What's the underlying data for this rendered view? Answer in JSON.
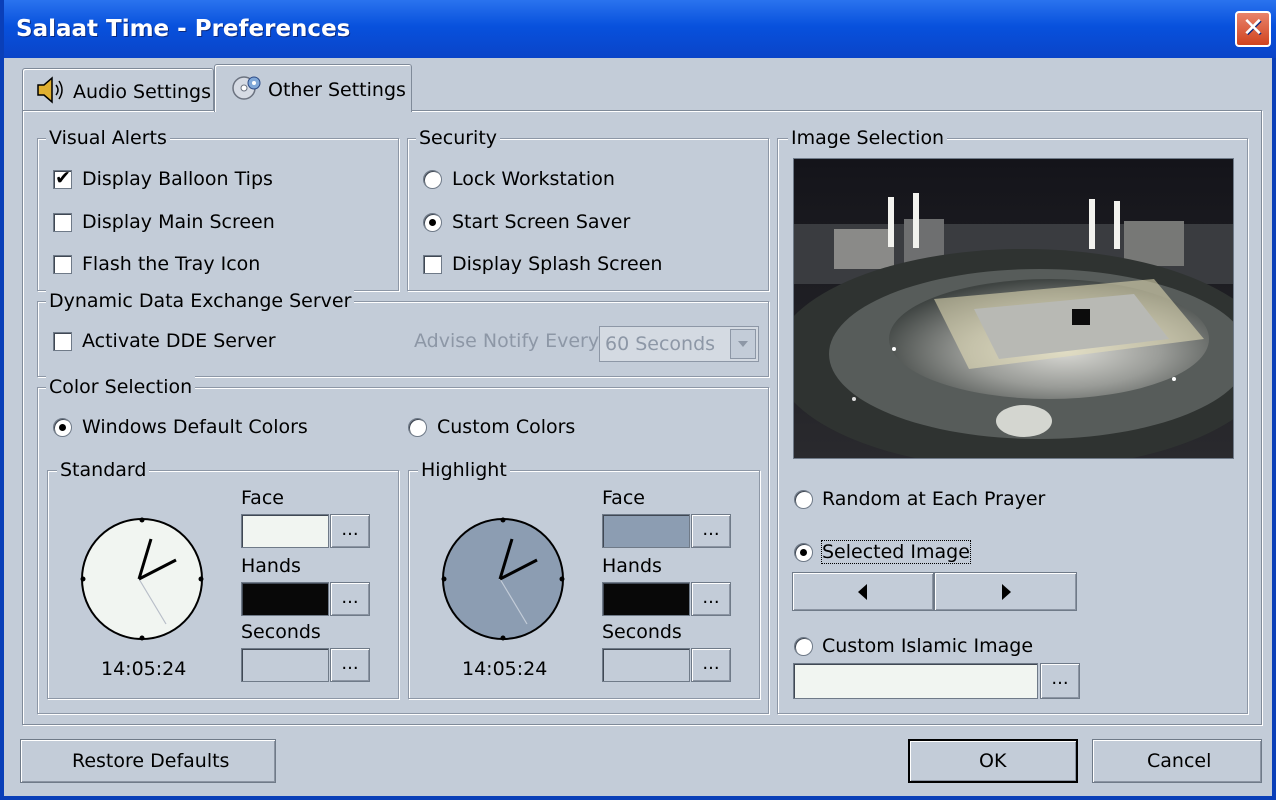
{
  "window": {
    "title": "Salaat Time - Preferences",
    "close_glyph": "✕"
  },
  "tabs": [
    {
      "label": "Audio Settings",
      "icon": "speaker-icon",
      "selected": false
    },
    {
      "label": "Other Settings",
      "icon": "cd-settings-icon",
      "selected": true
    }
  ],
  "visual_alerts": {
    "legend": "Visual Alerts",
    "items": [
      {
        "label": "Display Balloon Tips",
        "checked": true
      },
      {
        "label": "Display Main Screen",
        "checked": false
      },
      {
        "label": "Flash the Tray Icon",
        "checked": false
      }
    ]
  },
  "security": {
    "legend": "Security",
    "lock_workstation": "Lock Workstation",
    "start_screen_saver": "Start Screen Saver",
    "display_splash": "Display Splash Screen",
    "selected": "Start Screen Saver"
  },
  "dde": {
    "legend": "Dynamic Data Exchange Server",
    "activate_label": "Activate DDE Server",
    "advise_label": "Advise Notify Every",
    "interval_value": "60 Seconds"
  },
  "color_selection": {
    "legend": "Color Selection",
    "windows_default": "Windows Default Colors",
    "custom": "Custom Colors",
    "selected": "Windows Default Colors",
    "standard": {
      "legend": "Standard",
      "face_label": "Face",
      "hands_label": "Hands",
      "seconds_label": "Seconds",
      "face_color": "#f1f5f1",
      "hands_color": "#080808",
      "seconds_color": "#c3ccd8",
      "time": "14:05:24"
    },
    "highlight": {
      "legend": "Highlight",
      "face_label": "Face",
      "hands_label": "Hands",
      "seconds_label": "Seconds",
      "face_color": "#8c9db2",
      "hands_color": "#080808",
      "seconds_color": "#c3ccd8",
      "time": "14:05:24"
    },
    "browse_label": "..."
  },
  "image_selection": {
    "legend": "Image Selection",
    "random": "Random at Each Prayer",
    "selected_image": "Selected Image",
    "custom_image": "Custom Islamic Image",
    "selected": "Selected Image",
    "custom_path": "",
    "browse_label": "..."
  },
  "footer": {
    "restore": "Restore Defaults",
    "ok": "OK",
    "cancel": "Cancel"
  },
  "colors": {
    "title_bar": "#0851dd",
    "dialog_bg": "#c3ccd8"
  }
}
